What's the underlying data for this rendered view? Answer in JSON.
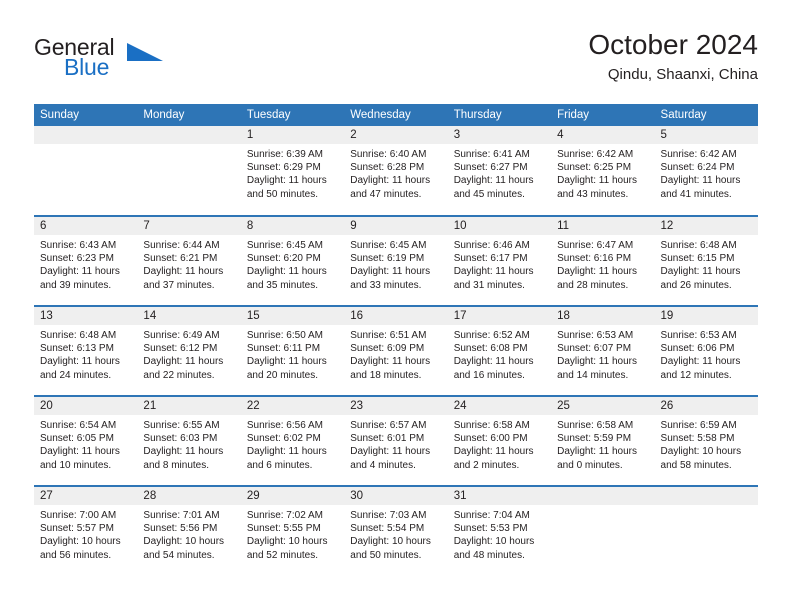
{
  "brand": {
    "name_part1": "General",
    "name_part2": "Blue",
    "triangle_icon": "triangle-icon",
    "accent_color": "#1a6fc4"
  },
  "header": {
    "title": "October 2024",
    "subtitle": "Qindu, Shaanxi, China"
  },
  "calendar": {
    "header_color": "#2e75b6",
    "daynum_band_color": "#efefef",
    "weekday_headers": [
      "Sunday",
      "Monday",
      "Tuesday",
      "Wednesday",
      "Thursday",
      "Friday",
      "Saturday"
    ],
    "weeks": [
      [
        {
          "day": "",
          "sunrise": "",
          "sunset": "",
          "daylight_line1": "",
          "daylight_line2": ""
        },
        {
          "day": "",
          "sunrise": "",
          "sunset": "",
          "daylight_line1": "",
          "daylight_line2": ""
        },
        {
          "day": "1",
          "sunrise": "Sunrise: 6:39 AM",
          "sunset": "Sunset: 6:29 PM",
          "daylight_line1": "Daylight: 11 hours",
          "daylight_line2": "and 50 minutes."
        },
        {
          "day": "2",
          "sunrise": "Sunrise: 6:40 AM",
          "sunset": "Sunset: 6:28 PM",
          "daylight_line1": "Daylight: 11 hours",
          "daylight_line2": "and 47 minutes."
        },
        {
          "day": "3",
          "sunrise": "Sunrise: 6:41 AM",
          "sunset": "Sunset: 6:27 PM",
          "daylight_line1": "Daylight: 11 hours",
          "daylight_line2": "and 45 minutes."
        },
        {
          "day": "4",
          "sunrise": "Sunrise: 6:42 AM",
          "sunset": "Sunset: 6:25 PM",
          "daylight_line1": "Daylight: 11 hours",
          "daylight_line2": "and 43 minutes."
        },
        {
          "day": "5",
          "sunrise": "Sunrise: 6:42 AM",
          "sunset": "Sunset: 6:24 PM",
          "daylight_line1": "Daylight: 11 hours",
          "daylight_line2": "and 41 minutes."
        }
      ],
      [
        {
          "day": "6",
          "sunrise": "Sunrise: 6:43 AM",
          "sunset": "Sunset: 6:23 PM",
          "daylight_line1": "Daylight: 11 hours",
          "daylight_line2": "and 39 minutes."
        },
        {
          "day": "7",
          "sunrise": "Sunrise: 6:44 AM",
          "sunset": "Sunset: 6:21 PM",
          "daylight_line1": "Daylight: 11 hours",
          "daylight_line2": "and 37 minutes."
        },
        {
          "day": "8",
          "sunrise": "Sunrise: 6:45 AM",
          "sunset": "Sunset: 6:20 PM",
          "daylight_line1": "Daylight: 11 hours",
          "daylight_line2": "and 35 minutes."
        },
        {
          "day": "9",
          "sunrise": "Sunrise: 6:45 AM",
          "sunset": "Sunset: 6:19 PM",
          "daylight_line1": "Daylight: 11 hours",
          "daylight_line2": "and 33 minutes."
        },
        {
          "day": "10",
          "sunrise": "Sunrise: 6:46 AM",
          "sunset": "Sunset: 6:17 PM",
          "daylight_line1": "Daylight: 11 hours",
          "daylight_line2": "and 31 minutes."
        },
        {
          "day": "11",
          "sunrise": "Sunrise: 6:47 AM",
          "sunset": "Sunset: 6:16 PM",
          "daylight_line1": "Daylight: 11 hours",
          "daylight_line2": "and 28 minutes."
        },
        {
          "day": "12",
          "sunrise": "Sunrise: 6:48 AM",
          "sunset": "Sunset: 6:15 PM",
          "daylight_line1": "Daylight: 11 hours",
          "daylight_line2": "and 26 minutes."
        }
      ],
      [
        {
          "day": "13",
          "sunrise": "Sunrise: 6:48 AM",
          "sunset": "Sunset: 6:13 PM",
          "daylight_line1": "Daylight: 11 hours",
          "daylight_line2": "and 24 minutes."
        },
        {
          "day": "14",
          "sunrise": "Sunrise: 6:49 AM",
          "sunset": "Sunset: 6:12 PM",
          "daylight_line1": "Daylight: 11 hours",
          "daylight_line2": "and 22 minutes."
        },
        {
          "day": "15",
          "sunrise": "Sunrise: 6:50 AM",
          "sunset": "Sunset: 6:11 PM",
          "daylight_line1": "Daylight: 11 hours",
          "daylight_line2": "and 20 minutes."
        },
        {
          "day": "16",
          "sunrise": "Sunrise: 6:51 AM",
          "sunset": "Sunset: 6:09 PM",
          "daylight_line1": "Daylight: 11 hours",
          "daylight_line2": "and 18 minutes."
        },
        {
          "day": "17",
          "sunrise": "Sunrise: 6:52 AM",
          "sunset": "Sunset: 6:08 PM",
          "daylight_line1": "Daylight: 11 hours",
          "daylight_line2": "and 16 minutes."
        },
        {
          "day": "18",
          "sunrise": "Sunrise: 6:53 AM",
          "sunset": "Sunset: 6:07 PM",
          "daylight_line1": "Daylight: 11 hours",
          "daylight_line2": "and 14 minutes."
        },
        {
          "day": "19",
          "sunrise": "Sunrise: 6:53 AM",
          "sunset": "Sunset: 6:06 PM",
          "daylight_line1": "Daylight: 11 hours",
          "daylight_line2": "and 12 minutes."
        }
      ],
      [
        {
          "day": "20",
          "sunrise": "Sunrise: 6:54 AM",
          "sunset": "Sunset: 6:05 PM",
          "daylight_line1": "Daylight: 11 hours",
          "daylight_line2": "and 10 minutes."
        },
        {
          "day": "21",
          "sunrise": "Sunrise: 6:55 AM",
          "sunset": "Sunset: 6:03 PM",
          "daylight_line1": "Daylight: 11 hours",
          "daylight_line2": "and 8 minutes."
        },
        {
          "day": "22",
          "sunrise": "Sunrise: 6:56 AM",
          "sunset": "Sunset: 6:02 PM",
          "daylight_line1": "Daylight: 11 hours",
          "daylight_line2": "and 6 minutes."
        },
        {
          "day": "23",
          "sunrise": "Sunrise: 6:57 AM",
          "sunset": "Sunset: 6:01 PM",
          "daylight_line1": "Daylight: 11 hours",
          "daylight_line2": "and 4 minutes."
        },
        {
          "day": "24",
          "sunrise": "Sunrise: 6:58 AM",
          "sunset": "Sunset: 6:00 PM",
          "daylight_line1": "Daylight: 11 hours",
          "daylight_line2": "and 2 minutes."
        },
        {
          "day": "25",
          "sunrise": "Sunrise: 6:58 AM",
          "sunset": "Sunset: 5:59 PM",
          "daylight_line1": "Daylight: 11 hours",
          "daylight_line2": "and 0 minutes."
        },
        {
          "day": "26",
          "sunrise": "Sunrise: 6:59 AM",
          "sunset": "Sunset: 5:58 PM",
          "daylight_line1": "Daylight: 10 hours",
          "daylight_line2": "and 58 minutes."
        }
      ],
      [
        {
          "day": "27",
          "sunrise": "Sunrise: 7:00 AM",
          "sunset": "Sunset: 5:57 PM",
          "daylight_line1": "Daylight: 10 hours",
          "daylight_line2": "and 56 minutes."
        },
        {
          "day": "28",
          "sunrise": "Sunrise: 7:01 AM",
          "sunset": "Sunset: 5:56 PM",
          "daylight_line1": "Daylight: 10 hours",
          "daylight_line2": "and 54 minutes."
        },
        {
          "day": "29",
          "sunrise": "Sunrise: 7:02 AM",
          "sunset": "Sunset: 5:55 PM",
          "daylight_line1": "Daylight: 10 hours",
          "daylight_line2": "and 52 minutes."
        },
        {
          "day": "30",
          "sunrise": "Sunrise: 7:03 AM",
          "sunset": "Sunset: 5:54 PM",
          "daylight_line1": "Daylight: 10 hours",
          "daylight_line2": "and 50 minutes."
        },
        {
          "day": "31",
          "sunrise": "Sunrise: 7:04 AM",
          "sunset": "Sunset: 5:53 PM",
          "daylight_line1": "Daylight: 10 hours",
          "daylight_line2": "and 48 minutes."
        },
        {
          "day": "",
          "sunrise": "",
          "sunset": "",
          "daylight_line1": "",
          "daylight_line2": ""
        },
        {
          "day": "",
          "sunrise": "",
          "sunset": "",
          "daylight_line1": "",
          "daylight_line2": ""
        }
      ]
    ]
  }
}
